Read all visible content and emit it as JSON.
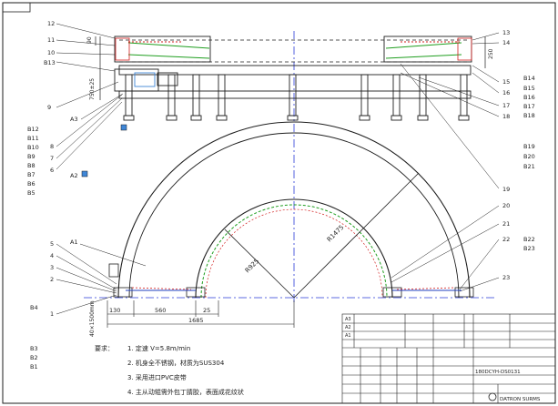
{
  "colors": {
    "line": "#1e1e1e",
    "blue": "#1f3fbf",
    "green": "#1f9e1f",
    "red": "#d21e1e",
    "center": "#2a3bd8",
    "ref_blue": "#3f86d6"
  },
  "drawing": {
    "side_labels_left": [
      "12",
      "11",
      "10",
      "B13",
      "9",
      "A3",
      "B12",
      "B11",
      "B10",
      "B9",
      "B8",
      "B7",
      "B6",
      "B5"
    ],
    "side_labels_left_numbers": [
      "8",
      "7",
      "6"
    ],
    "side_labels_right": [
      "13",
      "14",
      "15",
      "16",
      "17",
      "18",
      "19",
      "20",
      "21",
      "22",
      "23"
    ],
    "side_labels_right_B": [
      "B14",
      "B15",
      "B16",
      "B17",
      "B18",
      "B19",
      "B20",
      "B21",
      "B22",
      "B23"
    ],
    "lower_left_labels": [
      "5",
      "4",
      "3",
      "2",
      "1",
      "B4",
      "B3",
      "B2",
      "B1"
    ],
    "misc_labels": {
      "a1": "A1",
      "a2": "A2"
    },
    "dims": {
      "d_r1": "R925",
      "d_r2": "R1475",
      "d_h1": "130",
      "d_h2": "560",
      "d_h3": "25",
      "d_total": "1685",
      "d_v_left": "750±25",
      "d_v_bot": "40×1500mm",
      "d_v_right": "250",
      "d_top_small": "90"
    }
  },
  "notes": {
    "title": "要求：",
    "items": [
      "1. 定速 V=5.8m/min",
      "2. 机身全不锈钢，材质为SUS304",
      "3. 采用进口PVC皮带",
      "4. 主从动辊需外包丁腈胶，表面成花纹状"
    ]
  },
  "title_block": {
    "code": "180DCYH-DS0131",
    "logo_text": "DATRON SURMS",
    "row_labels": [
      "A3",
      "A2",
      "A1",
      "A1",
      "A1"
    ]
  }
}
